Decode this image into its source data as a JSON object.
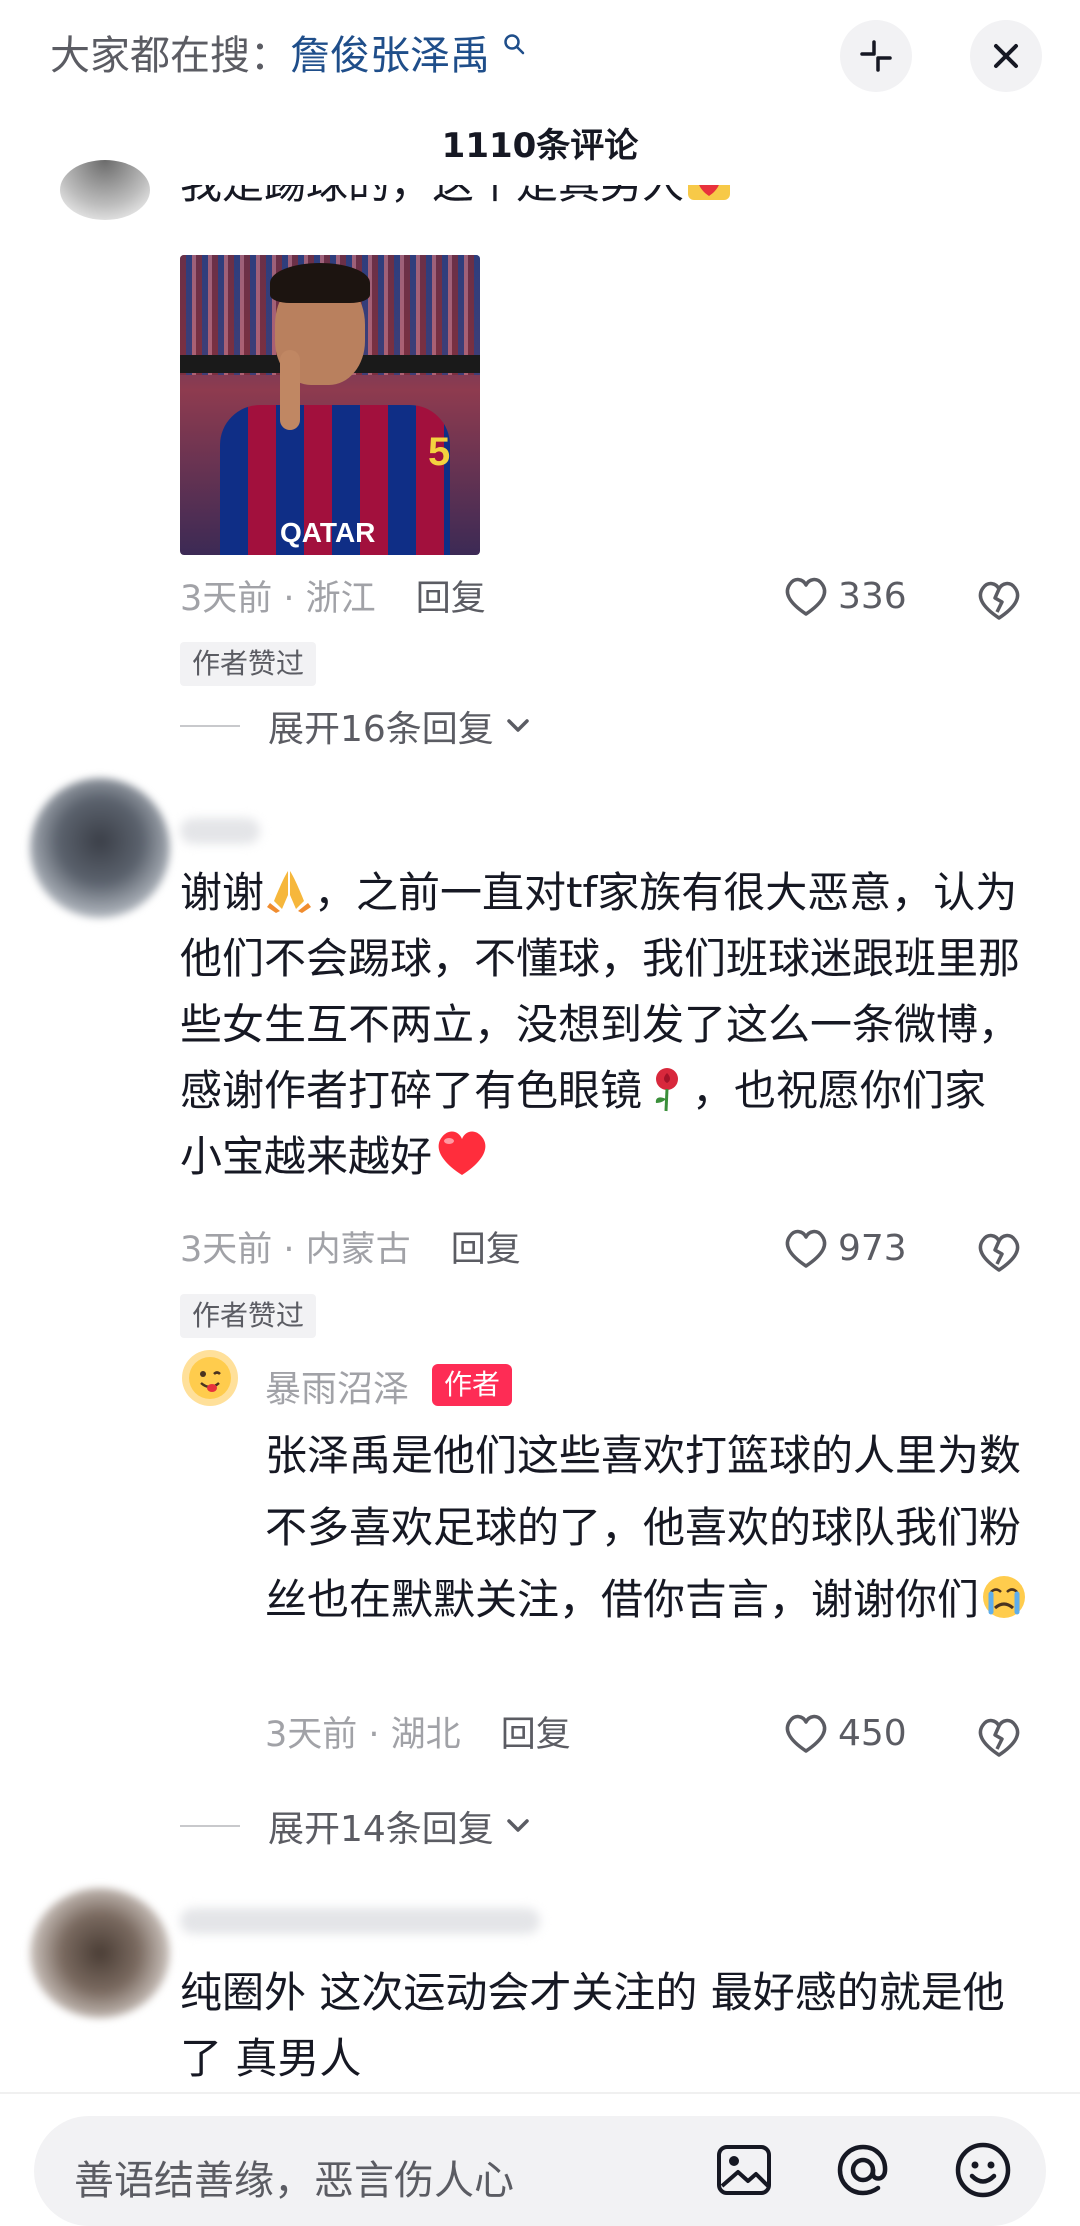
{
  "header": {
    "search_prefix": "大家都在搜：",
    "search_keyword": "詹俊张泽禹",
    "comment_count": "1110条评论",
    "collapse_icon": "collapse-icon",
    "close_icon": "close-icon"
  },
  "comments": [
    {
      "text_partial": "我是踢球的，这个是真男人",
      "has_image": true,
      "image_text": "QATAR",
      "time": "3天前",
      "location": "浙江",
      "reply_label": "回复",
      "likes": "336",
      "author_liked": "作者赞过",
      "expand_label": "展开16条回复"
    },
    {
      "text_parts": [
        "谢谢",
        "，之前一直对tf家族有很大恶意，认为他们不会踢球，不懂球，我们班球迷跟班里那些女生互不两立，没想到发了这么一条微博，感谢作者打碎了有色眼镜",
        "，也祝愿你们家小宝越来越好"
      ],
      "time": "3天前",
      "location": "内蒙古",
      "reply_label": "回复",
      "likes": "973",
      "author_liked": "作者赞过",
      "reply": {
        "username": "暴雨沼泽",
        "author_tag": "作者",
        "text_parts": [
          "张泽禹是他们这些喜欢打篮球的人里为数不多喜欢足球的了，他喜欢的球队我们粉丝也在默默关注，借你吉言，谢谢你们"
        ],
        "time": "3天前",
        "location": "湖北",
        "reply_label": "回复",
        "likes": "450"
      },
      "expand_label": "展开14条回复"
    },
    {
      "text": "纯圈外 这次运动会才关注的 最好感的就是他了 真男人"
    }
  ],
  "input": {
    "placeholder": "善语结善缘，恶言伤人心",
    "icons": [
      "image-icon",
      "at-icon",
      "emoji-icon"
    ]
  },
  "colors": {
    "accent_red": "#fe2c55",
    "keyword_blue": "#1f4e8a",
    "text_primary": "#161823",
    "text_secondary": "#a1a2a7"
  }
}
